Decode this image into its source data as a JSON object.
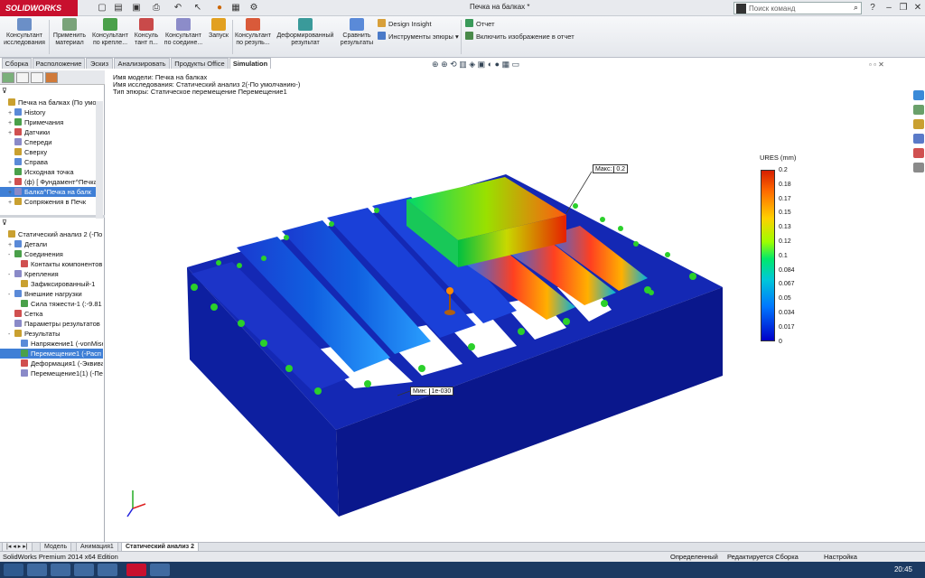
{
  "app": {
    "logo": "SOLIDWORKS",
    "doc_title": "Печка на балках *"
  },
  "search": {
    "placeholder": "Поиск команд"
  },
  "ribbon": {
    "buttons": [
      {
        "label1": "Консультант",
        "label2": "исследования"
      },
      {
        "label1": "Применить",
        "label2": "материал"
      },
      {
        "label1": "Консультант",
        "label2": "по крепле..."
      },
      {
        "label1": "Консуль",
        "label2": "тант п..."
      },
      {
        "label1": "Консультант",
        "label2": "по соедине..."
      },
      {
        "label1": "Запуск",
        "label2": ""
      },
      {
        "label1": "Консультант",
        "label2": "по резуль..."
      },
      {
        "label1": "Деформированный",
        "label2": "результат"
      },
      {
        "label1": "Сравнить",
        "label2": "результаты"
      }
    ],
    "small": [
      "Design Insight",
      "Инструменты эпюры",
      "Отчет",
      "Включить изображение в отчет"
    ]
  },
  "tabs": [
    "Сборка",
    "Расположение",
    "Эскиз",
    "Анализировать",
    "Продукты Office",
    "Simulation"
  ],
  "tree_top": [
    {
      "label": "Печка на балках  (По умолч",
      "pm": ""
    },
    {
      "label": "History",
      "pm": "+"
    },
    {
      "label": "Примечания",
      "pm": "+"
    },
    {
      "label": "Датчики",
      "pm": "+"
    },
    {
      "label": "Спереди",
      "pm": ""
    },
    {
      "label": "Сверху",
      "pm": ""
    },
    {
      "label": "Справа",
      "pm": ""
    },
    {
      "label": "Исходная точка",
      "pm": ""
    },
    {
      "label": "(ф) [ Фундамент^Печка",
      "pm": "+"
    },
    {
      "label": "Балка^Печка на балк",
      "pm": "+"
    },
    {
      "label": "Сопряжения в Печк",
      "pm": "+"
    }
  ],
  "tree_bottom": [
    {
      "label": "Статический анализ 2 (-По ум",
      "pm": "",
      "indent": 0
    },
    {
      "label": "Детали",
      "pm": "+",
      "indent": 1
    },
    {
      "label": "Соединения",
      "pm": "-",
      "indent": 1
    },
    {
      "label": "Контакты компонентов",
      "pm": "",
      "indent": 2
    },
    {
      "label": "Крепления",
      "pm": "-",
      "indent": 1
    },
    {
      "label": "Зафиксированный-1",
      "pm": "",
      "indent": 2
    },
    {
      "label": "Внешние нагрузки",
      "pm": "-",
      "indent": 1
    },
    {
      "label": "Сила тяжести-1 (:-9.81 г",
      "pm": "",
      "indent": 2
    },
    {
      "label": "Сетка",
      "pm": "",
      "indent": 1
    },
    {
      "label": "Параметры результатов",
      "pm": "",
      "indent": 1
    },
    {
      "label": "Результаты",
      "pm": "-",
      "indent": 1
    },
    {
      "label": "Напряжение1 (-vonMise",
      "pm": "",
      "indent": 2
    },
    {
      "label": "Перемещение1 (-Расп",
      "pm": "",
      "indent": 2
    },
    {
      "label": "Деформация1 (-Эквива",
      "pm": "",
      "indent": 2
    },
    {
      "label": "Перемещение1(1) (-Пер",
      "pm": "",
      "indent": 2
    }
  ],
  "info": {
    "model": "Имя модели: Печка на балках",
    "study": "Имя исследования: Статический анализ 2(-По умолчанию-)",
    "plot": "Тип эпюры: Статическое перемещение Перемещение1"
  },
  "legend": {
    "title": "URES (mm)",
    "values": [
      "0.2",
      "0.18",
      "0.17",
      "0.15",
      "0.13",
      "0.12",
      "0.1",
      "0.084",
      "0.067",
      "0.05",
      "0.034",
      "0.017",
      "0"
    ]
  },
  "callouts": {
    "max_label": "Макс:",
    "max_value": "0.2",
    "min_label": "Мин:",
    "min_value": "1e-030"
  },
  "bottom_tabs": [
    "Модель",
    "Анимация1",
    "Статический анализ 2"
  ],
  "status": {
    "edition": "SolidWorks Premium 2014 x64 Edition",
    "state": "Определенный",
    "editing": "Редактируется Сборка",
    "settings": "Настройка"
  },
  "clock": "20:45"
}
